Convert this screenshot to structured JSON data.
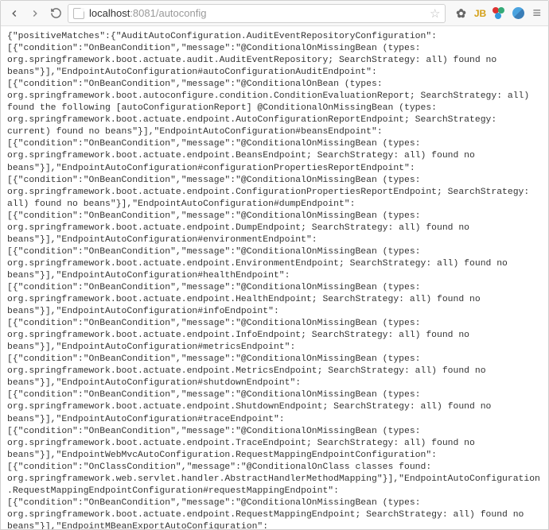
{
  "browser": {
    "url_host": "localhost",
    "url_port": ":8081",
    "url_path": "/autoconfig",
    "back_enabled": true,
    "forward_enabled": false,
    "extensions": {
      "jb_label": "JB"
    }
  },
  "body_text": "{\"positiveMatches\":{\"AuditAutoConfiguration.AuditEventRepositoryConfiguration\":[{\"condition\":\"OnBeanCondition\",\"message\":\"@ConditionalOnMissingBean (types: org.springframework.boot.actuate.audit.AuditEventRepository; SearchStrategy: all) found no beans\"}],\"EndpointAutoConfiguration#autoConfigurationAuditEndpoint\":[{\"condition\":\"OnBeanCondition\",\"message\":\"@ConditionalOnBean (types: org.springframework.boot.autoconfigure.condition.ConditionEvaluationReport; SearchStrategy: all) found the following [autoConfigurationReport] @ConditionalOnMissingBean (types: org.springframework.boot.actuate.endpoint.AutoConfigurationReportEndpoint; SearchStrategy: current) found no beans\"}],\"EndpointAutoConfiguration#beansEndpoint\":[{\"condition\":\"OnBeanCondition\",\"message\":\"@ConditionalOnMissingBean (types: org.springframework.boot.actuate.endpoint.BeansEndpoint; SearchStrategy: all) found no beans\"}],\"EndpointAutoConfiguration#configurationPropertiesReportEndpoint\":[{\"condition\":\"OnBeanCondition\",\"message\":\"@ConditionalOnMissingBean (types: org.springframework.boot.actuate.endpoint.ConfigurationPropertiesReportEndpoint; SearchStrategy: all) found no beans\"}],\"EndpointAutoConfiguration#dumpEndpoint\":[{\"condition\":\"OnBeanCondition\",\"message\":\"@ConditionalOnMissingBean (types: org.springframework.boot.actuate.endpoint.DumpEndpoint; SearchStrategy: all) found no beans\"}],\"EndpointAutoConfiguration#environmentEndpoint\":[{\"condition\":\"OnBeanCondition\",\"message\":\"@ConditionalOnMissingBean (types: org.springframework.boot.actuate.endpoint.EnvironmentEndpoint; SearchStrategy: all) found no beans\"}],\"EndpointAutoConfiguration#healthEndpoint\":[{\"condition\":\"OnBeanCondition\",\"message\":\"@ConditionalOnMissingBean (types: org.springframework.boot.actuate.endpoint.HealthEndpoint; SearchStrategy: all) found no beans\"}],\"EndpointAutoConfiguration#infoEndpoint\":[{\"condition\":\"OnBeanCondition\",\"message\":\"@ConditionalOnMissingBean (types: org.springframework.boot.actuate.endpoint.InfoEndpoint; SearchStrategy: all) found no beans\"}],\"EndpointAutoConfiguration#metricsEndpoint\":[{\"condition\":\"OnBeanCondition\",\"message\":\"@ConditionalOnMissingBean (types: org.springframework.boot.actuate.endpoint.MetricsEndpoint; SearchStrategy: all) found no beans\"}],\"EndpointAutoConfiguration#shutdownEndpoint\":[{\"condition\":\"OnBeanCondition\",\"message\":\"@ConditionalOnMissingBean (types: org.springframework.boot.actuate.endpoint.ShutdownEndpoint; SearchStrategy: all) found no beans\"}],\"EndpointAutoConfiguration#traceEndpoint\":[{\"condition\":\"OnBeanCondition\",\"message\":\"@ConditionalOnMissingBean (types: org.springframework.boot.actuate.endpoint.TraceEndpoint; SearchStrategy: all) found no beans\"}],\"EndpointWebMvcAutoConfiguration.RequestMappingEndpointConfiguration\":[{\"condition\":\"OnClassCondition\",\"message\":\"@ConditionalOnClass classes found: org.springframework.web.servlet.handler.AbstractHandlerMethodMapping\"}],\"EndpointAutoConfiguration.RequestMappingEndpointConfiguration#requestMappingEndpoint\":[{\"condition\":\"OnBeanCondition\",\"message\":\"@ConditionalOnMissingBean (types: org.springframework.boot.actuate.endpoint.RequestMappingEndpoint; SearchStrategy: all) found no beans\"}],\"EndpointMBeanExportAutoConfiguration\":[{\"condition\":\"OnExpressionCondition\",\"message\":\"SpEL expression on org.springframework.boot.actuate.autoconfigure.EndpointMBeanExportAutoConfiguration: ${endpoints.jmx.enabled:true} &&"
}
